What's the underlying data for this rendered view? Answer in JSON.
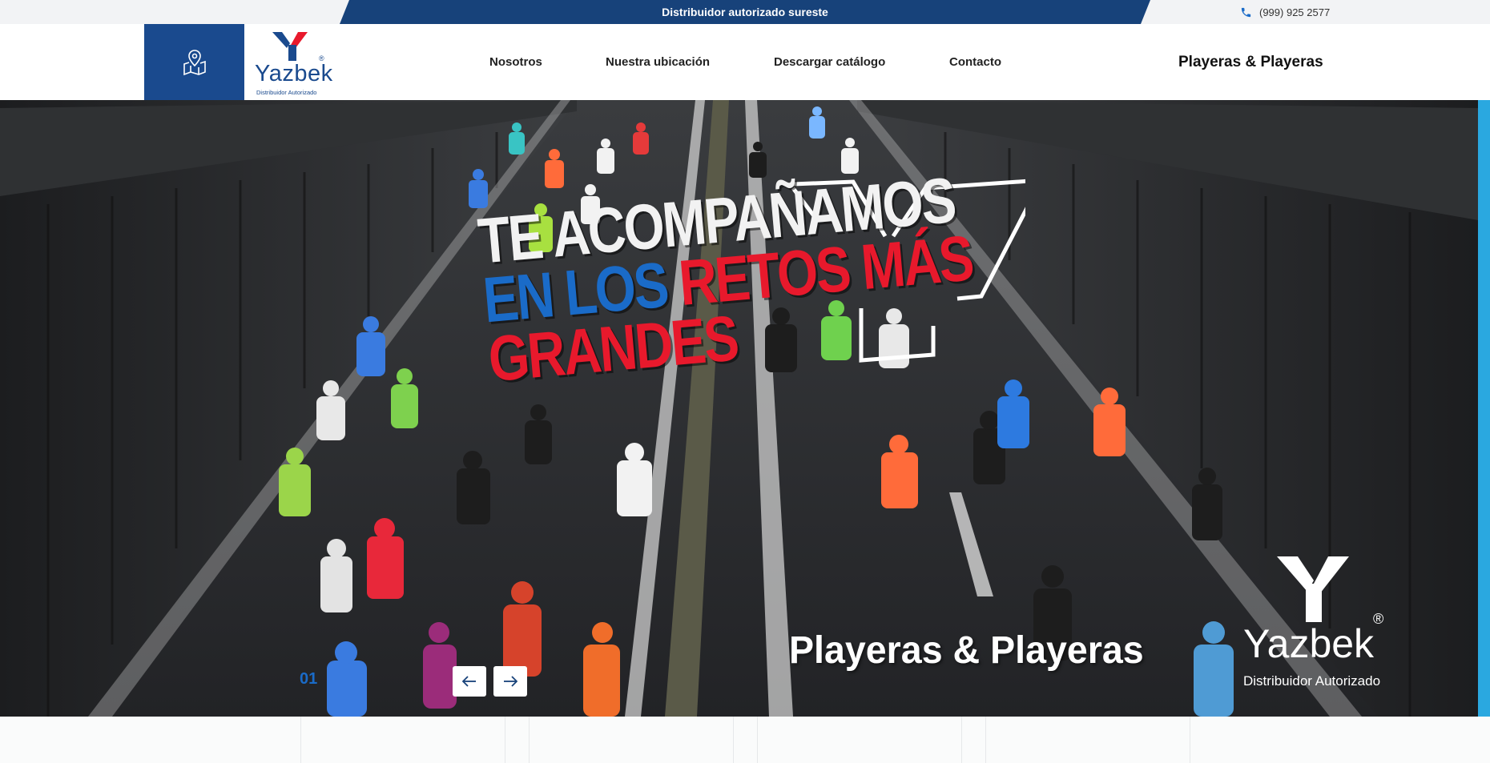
{
  "topbar": {
    "banner_text": "Distribuidor autorizado sureste",
    "phone": "(999) 925 2577",
    "phone_icon": "phone-icon"
  },
  "header": {
    "map_icon": "map-pin-icon",
    "logo": {
      "word": "Yazbek",
      "registered": "®",
      "tagline": "Distribuidor Autorizado"
    },
    "nav": [
      {
        "label": "Nosotros"
      },
      {
        "label": "Nuestra ubicación"
      },
      {
        "label": "Descargar catálogo"
      },
      {
        "label": "Contacto"
      }
    ],
    "brand": "Playeras & Playeras"
  },
  "hero": {
    "headline_line1": "TE ACOMPAÑAMOS",
    "headline_line2_blue": "EN LOS",
    "headline_line2_red": "RETOS MÁS",
    "headline_line3": "GRANDES",
    "brand": "Playeras & Playeras",
    "logo_word": "Yazbek",
    "logo_registered": "®",
    "logo_tagline": "Distribuidor Autorizado",
    "slide_number": "01",
    "prev_icon": "arrow-left-icon",
    "next_icon": "arrow-right-icon"
  },
  "colors": {
    "brand_blue": "#17427a",
    "accent_blue": "#1a6bc8",
    "accent_red": "#e8192c",
    "side_accent": "#2aa8e0"
  }
}
